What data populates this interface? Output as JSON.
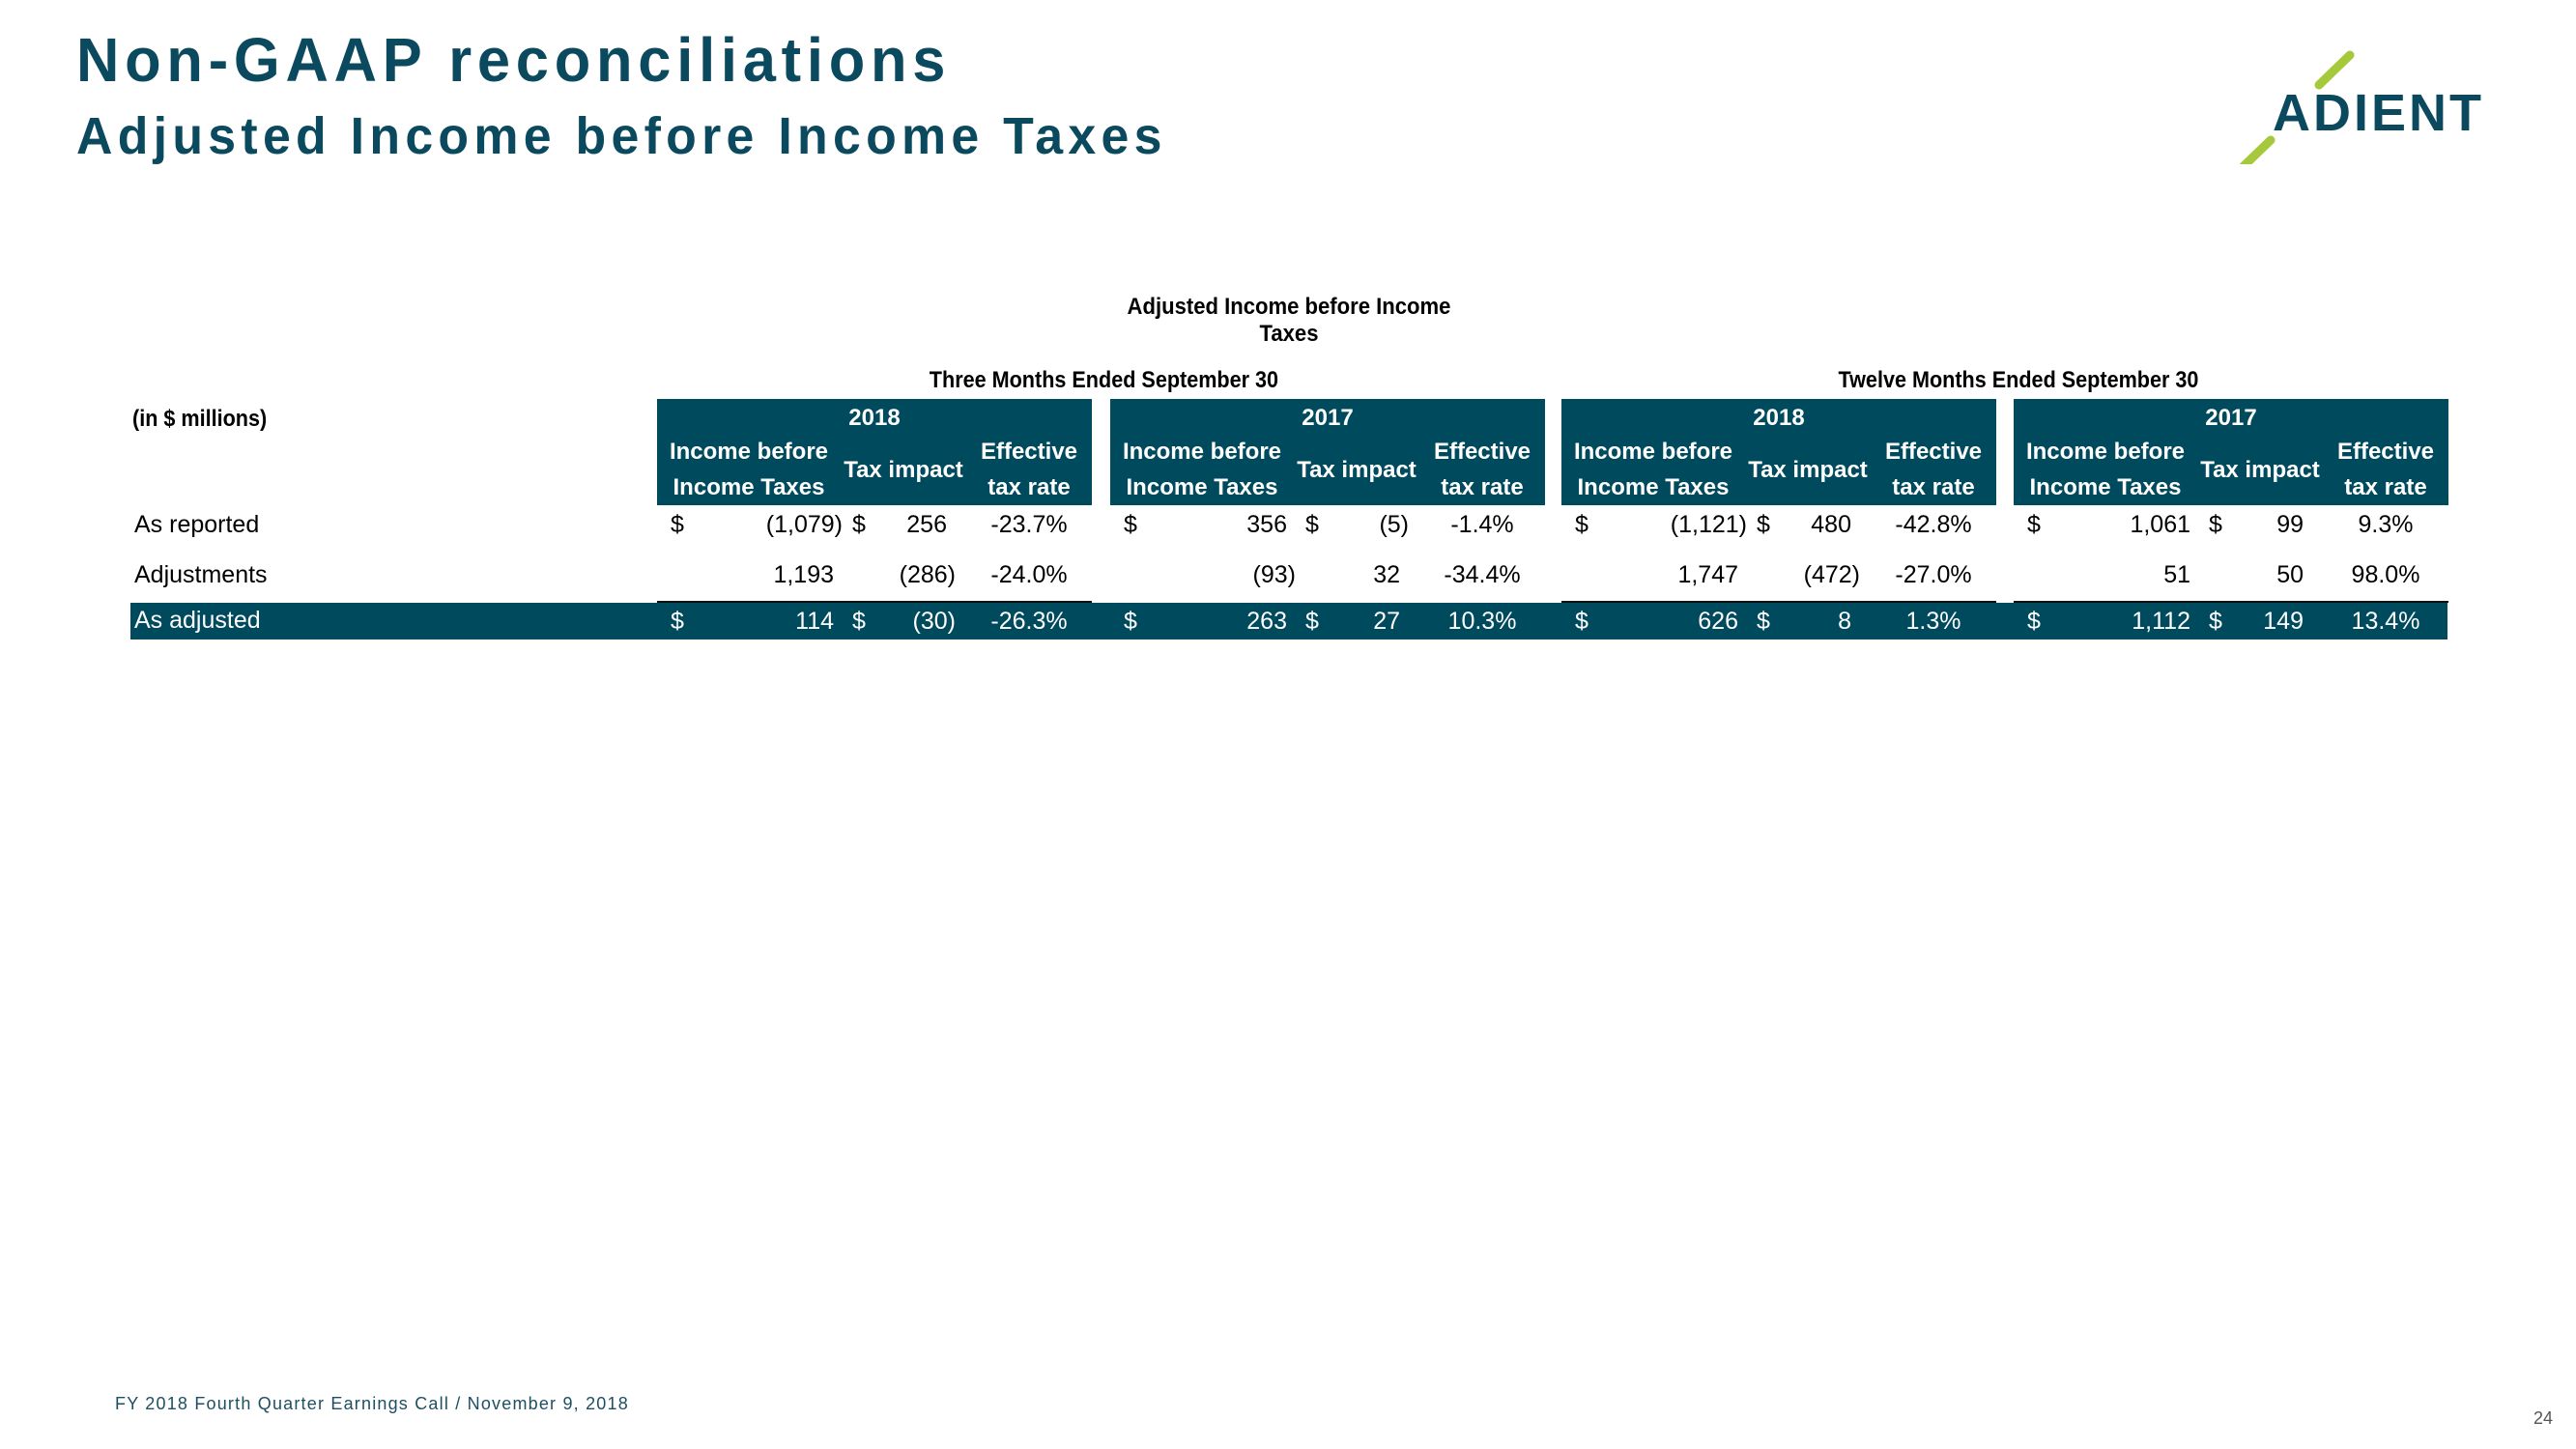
{
  "header": {
    "title": "Non-GAAP reconciliations",
    "subtitle": "Adjusted Income before Income Taxes",
    "logo_text": "ADIENT"
  },
  "colors": {
    "brand_teal": "#004a5e",
    "title_teal": "#0b4a5e",
    "logo_green": "#a5c93a"
  },
  "table": {
    "title": "Adjusted Income before Income Taxes",
    "units_label": "(in $ millions)",
    "periods": [
      "Three Months Ended September 30",
      "Twelve Months Ended September 30"
    ],
    "column_headers": {
      "income_line1": "Income before",
      "income_line2": "Income Taxes",
      "tax": "Tax impact",
      "rate_line1": "Effective",
      "rate_line2": "tax rate"
    },
    "row_labels": [
      "As reported",
      "Adjustments",
      "As adjusted"
    ],
    "currency_symbol": "$",
    "blocks": [
      {
        "period": "Three Months Ended September 30",
        "year": "2018",
        "rows": [
          {
            "income": "(1,079)",
            "tax": "256",
            "rate": "-23.7%",
            "show_currency": true
          },
          {
            "income": "1,193",
            "tax": "(286)",
            "rate": "-24.0%",
            "show_currency": false
          },
          {
            "income": "114",
            "tax": "(30)",
            "rate": "-26.3%",
            "show_currency": true
          }
        ]
      },
      {
        "period": "Three Months Ended September 30",
        "year": "2017",
        "rows": [
          {
            "income": "356",
            "tax": "(5)",
            "rate": "-1.4%",
            "show_currency": true
          },
          {
            "income": "(93)",
            "tax": "32",
            "rate": "-34.4%",
            "show_currency": false
          },
          {
            "income": "263",
            "tax": "27",
            "rate": "10.3%",
            "show_currency": true
          }
        ]
      },
      {
        "period": "Twelve Months Ended September 30",
        "year": "2018",
        "rows": [
          {
            "income": "(1,121)",
            "tax": "480",
            "rate": "-42.8%",
            "show_currency": true
          },
          {
            "income": "1,747",
            "tax": "(472)",
            "rate": "-27.0%",
            "show_currency": false
          },
          {
            "income": "626",
            "tax": "8",
            "rate": "1.3%",
            "show_currency": true
          }
        ]
      },
      {
        "period": "Twelve Months Ended September 30",
        "year": "2017",
        "rows": [
          {
            "income": "1,061",
            "tax": "99",
            "rate": "9.3%",
            "show_currency": true
          },
          {
            "income": "51",
            "tax": "50",
            "rate": "98.0%",
            "show_currency": false
          },
          {
            "income": "1,112",
            "tax": "149",
            "rate": "13.4%",
            "show_currency": true
          }
        ]
      }
    ]
  },
  "footer": {
    "text": "FY 2018 Fourth Quarter Earnings Call / November 9, 2018",
    "page_number": "24"
  }
}
